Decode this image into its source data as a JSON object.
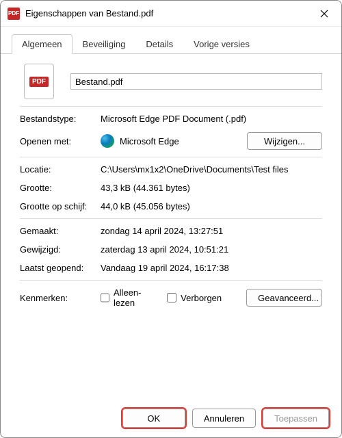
{
  "window": {
    "title": "Eigenschappen van Bestand.pdf",
    "app_icon_label": "PDF"
  },
  "tabs": {
    "general": "Algemeen",
    "security": "Beveiliging",
    "details": "Details",
    "previous": "Vorige versies"
  },
  "file": {
    "icon_label": "PDF",
    "name": "Bestand.pdf"
  },
  "labels": {
    "filetype": "Bestandstype:",
    "openwith": "Openen met:",
    "change": "Wijzigen...",
    "location": "Locatie:",
    "size": "Grootte:",
    "size_on_disk": "Grootte op schijf:",
    "created": "Gemaakt:",
    "modified": "Gewijzigd:",
    "accessed": "Laatst geopend:",
    "attributes": "Kenmerken:",
    "readonly": "Alleen-lezen",
    "hidden": "Verborgen",
    "advanced": "Geavanceerd..."
  },
  "values": {
    "filetype": "Microsoft Edge PDF Document (.pdf)",
    "openwith_app": "Microsoft Edge",
    "location": "C:\\Users\\mx1x2\\OneDrive\\Documents\\Test files",
    "size": "43,3 kB (44.361 bytes)",
    "size_on_disk": "44,0 kB (45.056 bytes)",
    "created": "zondag 14 april 2024, 13:27:51",
    "modified": "zaterdag 13 april 2024, 10:51:21",
    "accessed": "Vandaag 19 april 2024, 16:17:38"
  },
  "buttons": {
    "ok": "OK",
    "cancel": "Annuleren",
    "apply": "Toepassen"
  }
}
